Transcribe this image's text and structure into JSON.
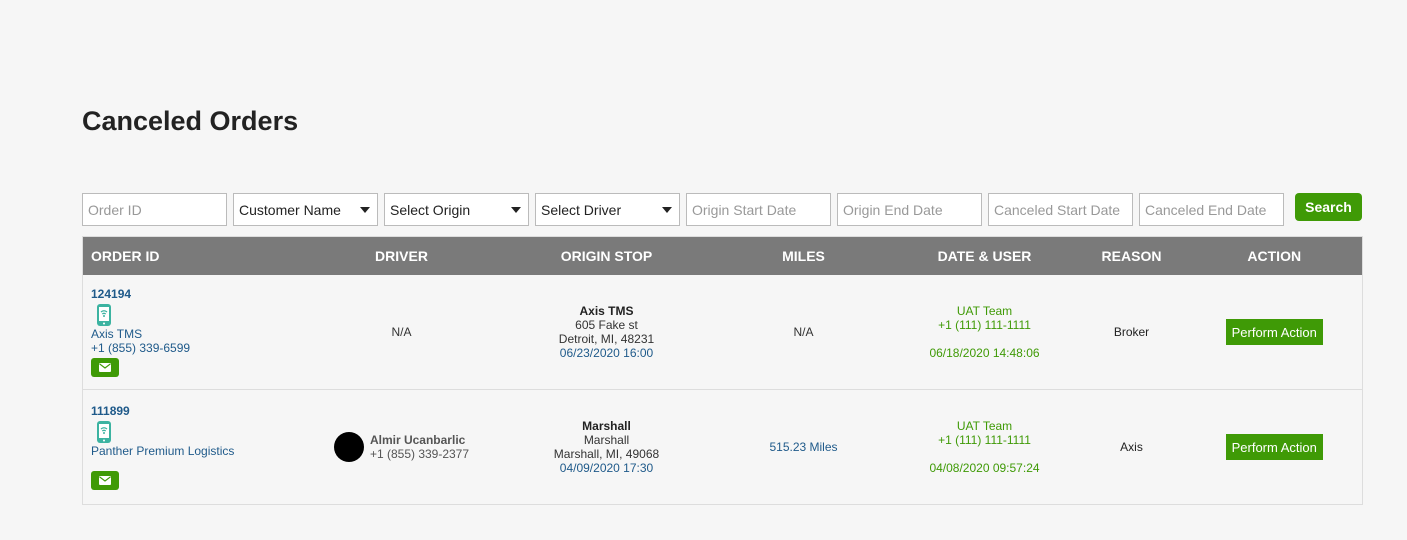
{
  "page": {
    "title": "Canceled Orders"
  },
  "filters": {
    "order_id_placeholder": "Order ID",
    "customer_select": "Customer Name",
    "origin_select": "Select Origin",
    "driver_select": "Select Driver",
    "origin_start_placeholder": "Origin Start Date",
    "origin_end_placeholder": "Origin End Date",
    "canceled_start_placeholder": "Canceled Start Date",
    "canceled_end_placeholder": "Canceled End Date",
    "search_label": "Search"
  },
  "table": {
    "headers": [
      "ORDER ID",
      "DRIVER",
      "ORIGIN STOP",
      "MILES",
      "DATE & USER",
      "REASON",
      "ACTION"
    ],
    "rows": [
      {
        "order_id": "124194",
        "customer": "Axis TMS",
        "customer_phone": "+1 (855) 339-6599",
        "driver_na": "N/A",
        "stop_name": "Axis TMS",
        "stop_address": "605 Fake st",
        "stop_city": "Detroit, MI, 48231",
        "stop_date": "06/23/2020 16:00",
        "miles": "N/A",
        "user": "UAT Team",
        "user_phone": "+1 (111) 111-1111",
        "canceled_date": "06/18/2020 14:48:06",
        "reason": "Broker",
        "action_label": "Perform Action"
      },
      {
        "order_id": "111899",
        "customer": "Panther Premium Logistics",
        "driver_name": "Almir Ucanbarlic",
        "driver_phone": "+1 (855) 339-2377",
        "stop_name": "Marshall",
        "stop_address": "Marshall",
        "stop_city": "Marshall, MI, 49068",
        "stop_date": "04/09/2020 17:30",
        "miles": "515.23 Miles",
        "user": "UAT Team",
        "user_phone": "+1 (111) 111-1111",
        "canceled_date": "04/08/2020 09:57:24",
        "reason": "Axis",
        "action_label": "Perform Action"
      }
    ]
  },
  "icons": {
    "phone": "mobile-phone-wifi-icon",
    "mail": "envelope-icon",
    "caret": "caret-down-icon"
  },
  "colors": {
    "accent_green": "#3f9a06",
    "link_blue": "#1f5a8a",
    "header_gray": "#7a7a7a",
    "phone_icon_teal": "#3cb3a1"
  }
}
